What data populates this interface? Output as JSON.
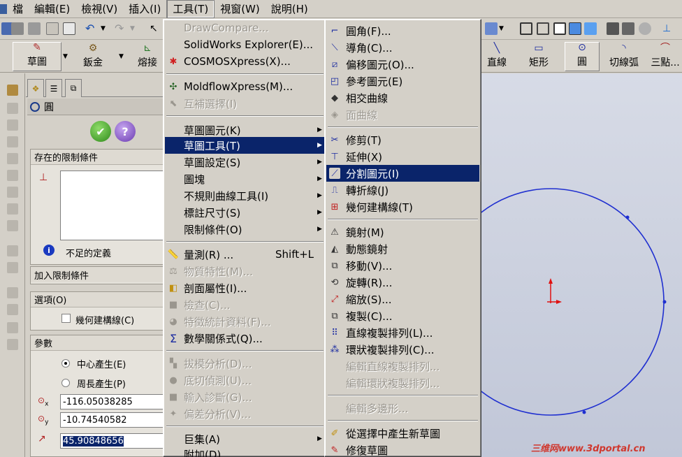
{
  "menubar": {
    "items": [
      {
        "label": "檔"
      },
      {
        "label": "編輯(E)"
      },
      {
        "label": "檢視(V)"
      },
      {
        "label": "插入(I)"
      },
      {
        "label": "工具(T)"
      },
      {
        "label": "視窗(W)"
      },
      {
        "label": "說明(H)"
      }
    ]
  },
  "sketch_toolbar": {
    "left_buttons": [
      {
        "label": "草圖",
        "icon": "sketch-icon"
      },
      {
        "label": "鈑金",
        "icon": "sheetmetal-icon"
      },
      {
        "label": "熔接",
        "icon": "weldment-icon"
      }
    ],
    "right_buttons": [
      {
        "label": "直線",
        "icon": "line-icon"
      },
      {
        "label": "矩形",
        "icon": "rectangle-icon"
      },
      {
        "label": "圓",
        "icon": "circle-icon"
      },
      {
        "label": "切線弧",
        "icon": "tangent-arc-icon"
      },
      {
        "label": "三點...",
        "icon": "three-point-arc-icon"
      }
    ]
  },
  "property_manager": {
    "title": "圓",
    "existing_relations": {
      "header": "存在的限制條件",
      "status": "不足的定義"
    },
    "add_relations": {
      "header": "加入限制條件"
    },
    "options": {
      "header": "選項(O)",
      "construction_label": "幾何建構線(C)",
      "construction_checked": false
    },
    "parameters": {
      "header": "參數",
      "center_label": "中心產生(E)",
      "perimeter_label": "周長產生(P)",
      "selected": "center",
      "cx": "-116.05038285",
      "cy": "-10.74540582",
      "radius": "45.90848656"
    }
  },
  "tools_menu": {
    "items": [
      {
        "label": "DrawCompare...",
        "disabled": true
      },
      {
        "label": "SolidWorks Explorer(E)...",
        "disabled": false
      },
      {
        "label": "COSMOSXpress(X)...",
        "disabled": false,
        "icon": "cosmosxpress-icon"
      },
      {
        "label": "MoldflowXpress(M)...",
        "disabled": false,
        "icon": "moldflow-icon"
      },
      {
        "label": "互補選擇(I)",
        "disabled": true,
        "icon": "selection-icon"
      },
      {
        "label": "草圖圖元(K)",
        "submenu": true
      },
      {
        "label": "草圖工具(T)",
        "submenu": true,
        "highlighted": true
      },
      {
        "label": "草圖設定(S)",
        "submenu": true
      },
      {
        "label": "圖塊",
        "submenu": true
      },
      {
        "label": "不規則曲線工具(I)",
        "submenu": true
      },
      {
        "label": "標註尺寸(S)",
        "submenu": true
      },
      {
        "label": "限制條件(O)",
        "submenu": true
      },
      {
        "label": "量測(R) ...",
        "shortcut": "Shift+L",
        "icon": "measure-icon"
      },
      {
        "label": "物質特性(M)...",
        "disabled": true,
        "icon": "mass-properties-icon"
      },
      {
        "label": "剖面屬性(I)...",
        "icon": "section-properties-icon"
      },
      {
        "label": "檢查(C)...",
        "disabled": true,
        "icon": "check-icon"
      },
      {
        "label": "特徵統計資料(F)...",
        "disabled": true,
        "icon": "feature-statistics-icon"
      },
      {
        "label": "數學關係式(Q)...",
        "icon": "sigma-icon"
      },
      {
        "label": "拔模分析(D)...",
        "disabled": true,
        "icon": "draft-analysis-icon"
      },
      {
        "label": "底切偵測(U)...",
        "disabled": true,
        "icon": "undercut-icon"
      },
      {
        "label": "輸入診斷(G)...",
        "disabled": true,
        "icon": "import-diagnostics-icon"
      },
      {
        "label": "偏差分析(V)...",
        "disabled": true,
        "icon": "deviation-icon"
      },
      {
        "label": "巨集(A)",
        "submenu": true
      },
      {
        "label": "附加(D)..."
      }
    ]
  },
  "sketch_tools_submenu": {
    "items": [
      {
        "label": "圓角(F)...",
        "icon": "fillet-icon"
      },
      {
        "label": "導角(C)...",
        "icon": "chamfer-icon"
      },
      {
        "label": "偏移圖元(O)...",
        "icon": "offset-icon"
      },
      {
        "label": "參考圖元(E)",
        "icon": "convert-entities-icon"
      },
      {
        "label": "相交曲線",
        "icon": "intersection-curve-icon"
      },
      {
        "label": "面曲線",
        "disabled": true,
        "icon": "face-curves-icon"
      },
      {
        "label": "修剪(T)",
        "icon": "trim-icon"
      },
      {
        "label": "延伸(X)",
        "icon": "extend-icon"
      },
      {
        "label": "分割圖元(I)",
        "highlighted": true,
        "icon": "split-icon"
      },
      {
        "label": "轉折線(J)",
        "icon": "jog-line-icon"
      },
      {
        "label": "幾何建構線(T)",
        "icon": "construction-icon"
      },
      {
        "label": "鏡射(M)",
        "icon": "mirror-icon"
      },
      {
        "label": "動態鏡射",
        "icon": "dynamic-mirror-icon"
      },
      {
        "label": "移動(V)...",
        "icon": "move-icon"
      },
      {
        "label": "旋轉(R)...",
        "icon": "rotate-icon"
      },
      {
        "label": "縮放(S)...",
        "icon": "scale-icon"
      },
      {
        "label": "複製(C)...",
        "icon": "copy-icon"
      },
      {
        "label": "直線複製排列(L)...",
        "icon": "linear-pattern-icon"
      },
      {
        "label": "環狀複製排列(C)...",
        "icon": "circular-pattern-icon"
      },
      {
        "label": "編輯直線複製排列...",
        "disabled": true
      },
      {
        "label": "編輯環狀複製排列...",
        "disabled": true
      },
      {
        "label": "編輯多邊形...",
        "disabled": true
      },
      {
        "label": "從選擇中產生新草圖",
        "icon": "sketch-from-selection-icon"
      },
      {
        "label": "修復草圖",
        "icon": "repair-sketch-icon"
      }
    ]
  },
  "watermark": "三维网www.3dportal.cn",
  "colors": {
    "menu_highlight": "#0a246a",
    "sketch_curve": "#1f2fd0",
    "origin": "#e01010"
  }
}
